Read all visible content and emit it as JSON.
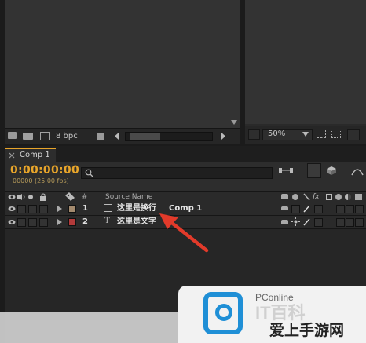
{
  "project_panel": {
    "bpc_label": "8 bpc"
  },
  "viewer": {
    "zoom": "50%"
  },
  "timeline": {
    "tab_label": "Comp 1",
    "timecode": "0:00:00:00",
    "frame_info": "00000 (25.00 fps)",
    "search_placeholder": "",
    "column_hash": "#",
    "column_source_name": "Source Name",
    "layers": [
      {
        "index": "1",
        "name": "这里是换行",
        "extra": "Comp 1",
        "label_color": "#a38a6e",
        "type": "comp-icon"
      },
      {
        "index": "2",
        "name": "这里是文字",
        "extra": "",
        "label_color": "#b23a3a",
        "type": "text-layer-icon"
      }
    ]
  },
  "watermark": {
    "brand": "PConline",
    "site": "爱上手游网",
    "letters": "IT百科"
  },
  "colors": {
    "timecode": "#e8a52a",
    "arrow": "#e23a2a"
  }
}
